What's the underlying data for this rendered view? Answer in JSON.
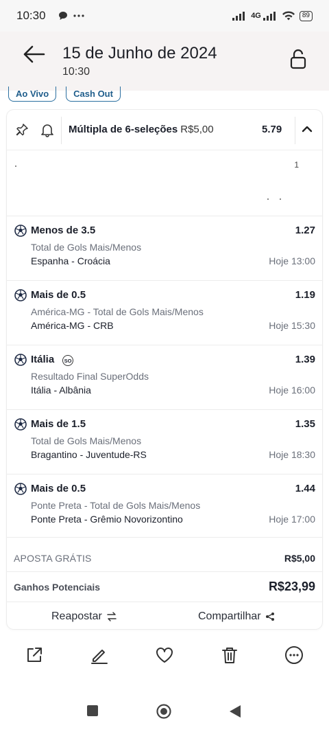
{
  "status_bar": {
    "time": "10:30",
    "network": "4G",
    "battery": "89"
  },
  "header": {
    "title": "15 de Junho de 2024",
    "subtitle": "10:30"
  },
  "chips": [
    "Ao Vivo",
    "Cash Out"
  ],
  "bet": {
    "title": "Múltipla de 6-seleções",
    "stake": "R$5,00",
    "total_odds": "5.79",
    "partial_digit": "1",
    "selections": [
      {
        "pick": "Menos de 3.5",
        "odds": "1.27",
        "market": "Total de Gols Mais/Menos",
        "event": "Espanha - Croácia",
        "time": "Hoje 13:00",
        "badge": ""
      },
      {
        "pick": "Mais de 0.5",
        "odds": "1.19",
        "market": "América-MG - Total de Gols Mais/Menos",
        "event": "América-MG - CRB",
        "time": "Hoje 15:30",
        "badge": ""
      },
      {
        "pick": "Itália",
        "odds": "1.39",
        "market": "Resultado Final SuperOdds",
        "event": "Itália - Albânia",
        "time": "Hoje 16:00",
        "badge": "SO"
      },
      {
        "pick": "Mais de 1.5",
        "odds": "1.35",
        "market": "Total de Gols Mais/Menos",
        "event": "Bragantino - Juventude-RS",
        "time": "Hoje 18:30",
        "badge": ""
      },
      {
        "pick": "Mais de 0.5",
        "odds": "1.44",
        "market": "Ponte Preta - Total de Gols Mais/Menos",
        "event": "Ponte Preta - Grêmio Novorizontino",
        "time": "Hoje 17:00",
        "badge": ""
      }
    ],
    "free_bet_label": "APOSTA GRÁTIS",
    "free_bet_value": "R$5,00",
    "potential_label": "Ganhos Potenciais",
    "potential_value": "R$23,99",
    "rebet_label": "Reapostar",
    "share_label": "Compartilhar"
  },
  "icons": {
    "back": "arrow-left-icon",
    "lock": "lock-icon",
    "pin": "pin-icon",
    "bell": "bell-icon",
    "chevron": "chevron-up-icon",
    "ball": "soccer-ball-icon",
    "rebet": "swap-icon",
    "share": "share-icon",
    "tools": [
      "open-external-icon",
      "edit-icon",
      "heart-icon",
      "trash-icon",
      "more-icon"
    ],
    "nav": [
      "recent-apps-icon",
      "home-icon",
      "back-icon"
    ]
  },
  "colors": {
    "chip_border": "#2a6fa0",
    "header_bg": "#f6f3f3",
    "muted_text": "#6a6f7a"
  }
}
